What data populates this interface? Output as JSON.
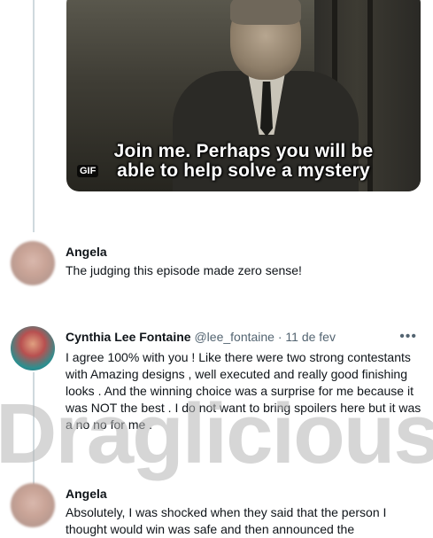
{
  "gif": {
    "caption_line1": "Join me. Perhaps you will be",
    "caption_line2": "able to help solve a mystery",
    "badge": "GIF"
  },
  "replies": [
    {
      "name": "Angela",
      "text": "The judging this episode made zero sense!"
    },
    {
      "name": "Cynthia Lee Fontaine",
      "handle": "@lee_fontaine · 11 de fev",
      "text": "I agree 100% with you ! Like there were two strong contestants with Amazing designs , well executed and really good finishing looks . And the winning choice was a surprise for me because it was NOT the best . I do not want to bring spoilers here but it was a no no for me ."
    },
    {
      "name": "Angela",
      "text": "Absolutely, I was shocked when they said that the person I thought would win was safe and then announced the"
    }
  ],
  "more_icon": "more-dots-icon",
  "watermark": "Draglicious"
}
